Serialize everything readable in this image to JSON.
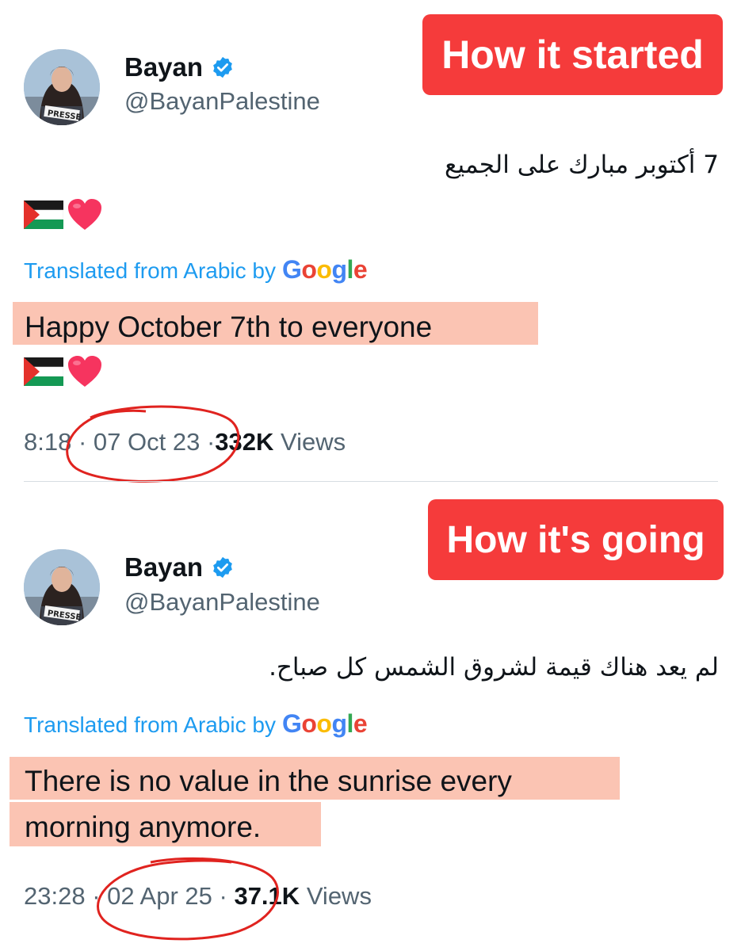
{
  "colors": {
    "accent_blue": "#1d9bf0",
    "banner_red": "#f53b3b",
    "highlight": "#fbc4b3",
    "annotation_red": "#e0231f"
  },
  "tweets": [
    {
      "banner": "How it started",
      "display_name": "Bayan",
      "handle": "@BayanPalestine",
      "avatar_badge": "PRESSE",
      "original_text": "7 أكتوبر مبارك على الجميع",
      "emojis": [
        "palestine-flag-emoji",
        "red-heart-emoji"
      ],
      "translated_label": "Translated from Arabic by",
      "translator": "Google",
      "translation_lines": [
        "Happy October 7th to everyone"
      ],
      "time": "8:18",
      "sep1": "·",
      "date": "07 Oct 23",
      "sep2": "·",
      "views_count": "332K",
      "views_label": "Views"
    },
    {
      "banner": "How it's going",
      "display_name": "Bayan",
      "handle": "@BayanPalestine",
      "avatar_badge": "PRESSE",
      "original_text": "لم يعد هناك قيمة لشروق الشمس كل صباح.",
      "translated_label": "Translated from Arabic by",
      "translator": "Google",
      "translation_lines": [
        "There is no value in the sunrise every",
        "morning anymore."
      ],
      "time": "23:28",
      "sep1": "·",
      "date": "02 Apr 25",
      "sep2": "·",
      "views_count": "37.1K",
      "views_label": "Views"
    }
  ]
}
